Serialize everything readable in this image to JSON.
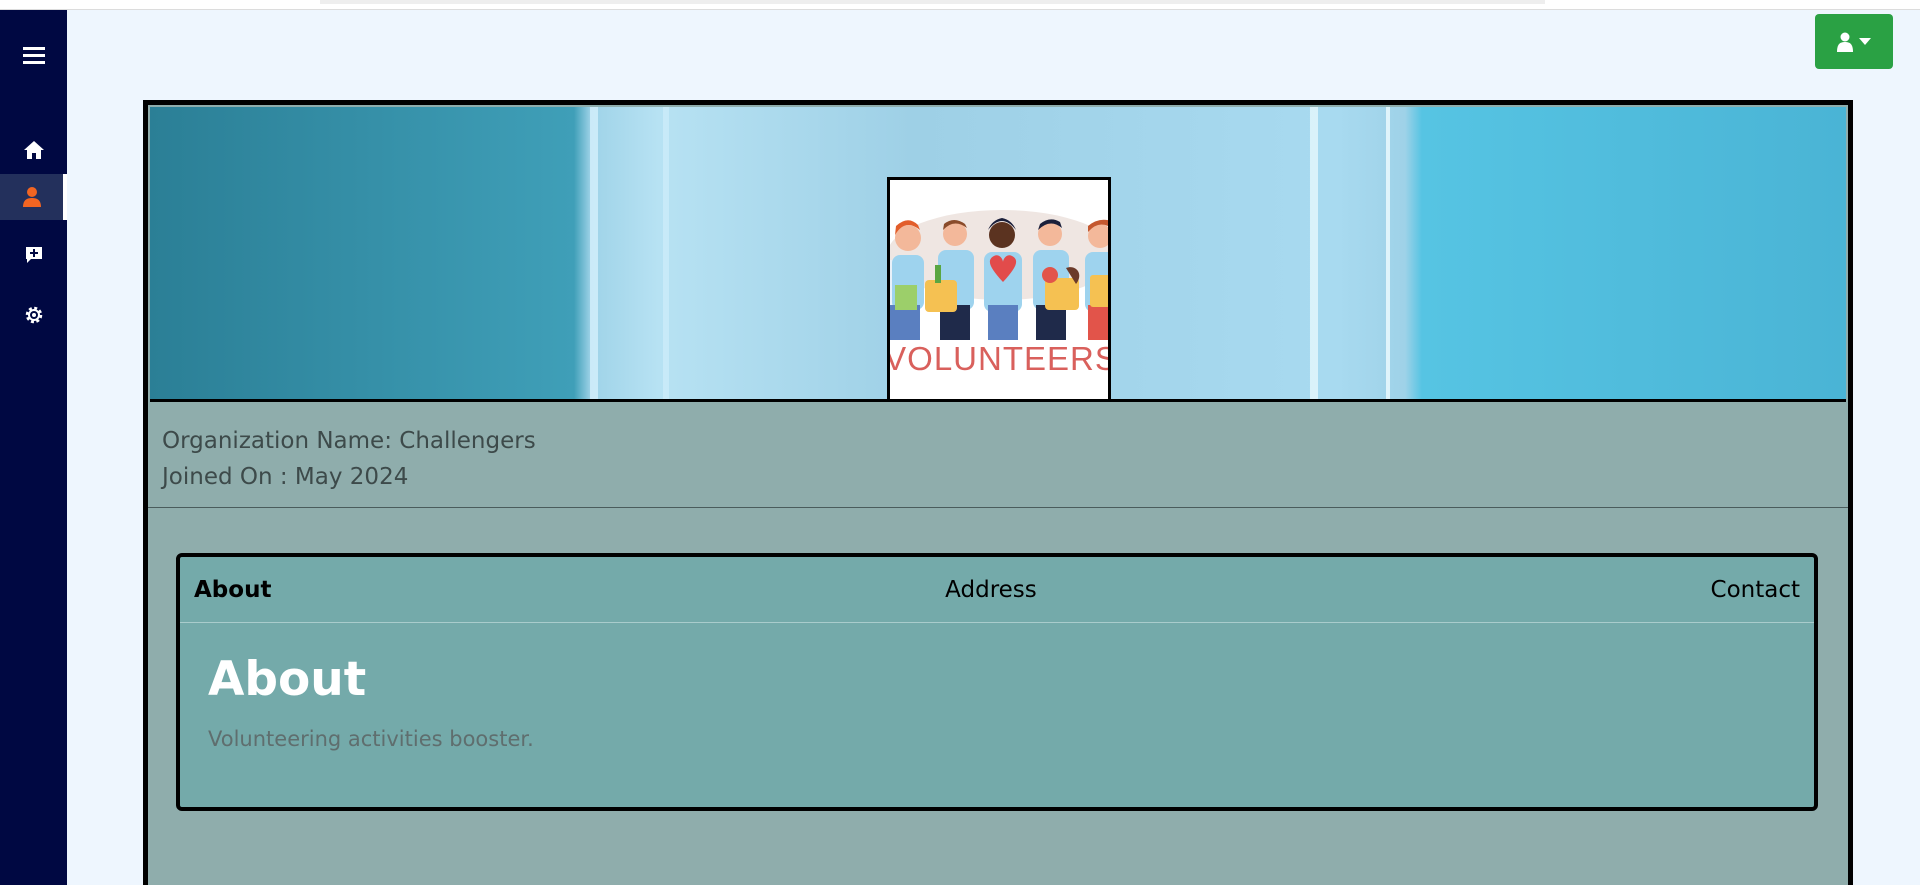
{
  "sidebar": {
    "items": [
      {
        "icon": "menu-icon"
      },
      {
        "icon": "home-icon"
      },
      {
        "icon": "user-icon",
        "active": true
      },
      {
        "icon": "chat-plus-icon"
      },
      {
        "icon": "gear-icon"
      }
    ],
    "active_color": "#f26522"
  },
  "header": {
    "user_menu_icon": "user-icon",
    "user_menu_color": "#2aa144"
  },
  "banner": {
    "logo_text": "VOLUNTEERS"
  },
  "profile": {
    "org_name": "Organization Name: Challengers",
    "joined": "Joined On : May 2024"
  },
  "tabs": [
    {
      "label": "About",
      "active": true
    },
    {
      "label": "Address"
    },
    {
      "label": "Contact"
    }
  ],
  "about": {
    "title": "About",
    "description": "Volunteering activities booster."
  }
}
